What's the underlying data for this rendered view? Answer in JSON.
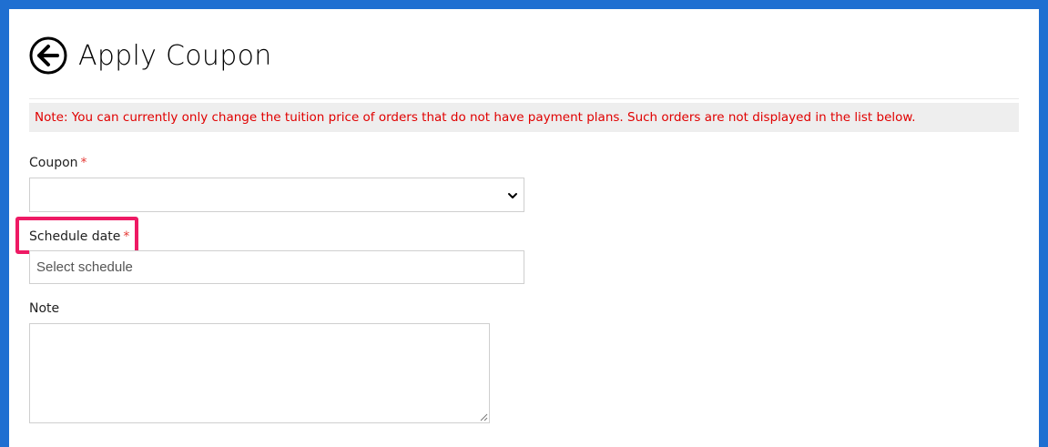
{
  "header": {
    "title": "Apply Coupon",
    "back_icon": "arrow-left-circle-icon"
  },
  "note": {
    "text": "Note: You can currently only change the tuition price of orders that do not have payment plans. Such orders are not displayed in the list below.",
    "color": "#e00000"
  },
  "form": {
    "coupon": {
      "label": "Coupon",
      "required_mark": "*",
      "value": ""
    },
    "schedule_date": {
      "label": "Schedule date",
      "required_mark": "*",
      "placeholder": "Select schedule",
      "value": ""
    },
    "note": {
      "label": "Note",
      "value": ""
    }
  },
  "colors": {
    "frame": "#1f6fd1",
    "highlight": "#ee1a64",
    "required": "#e53935"
  }
}
